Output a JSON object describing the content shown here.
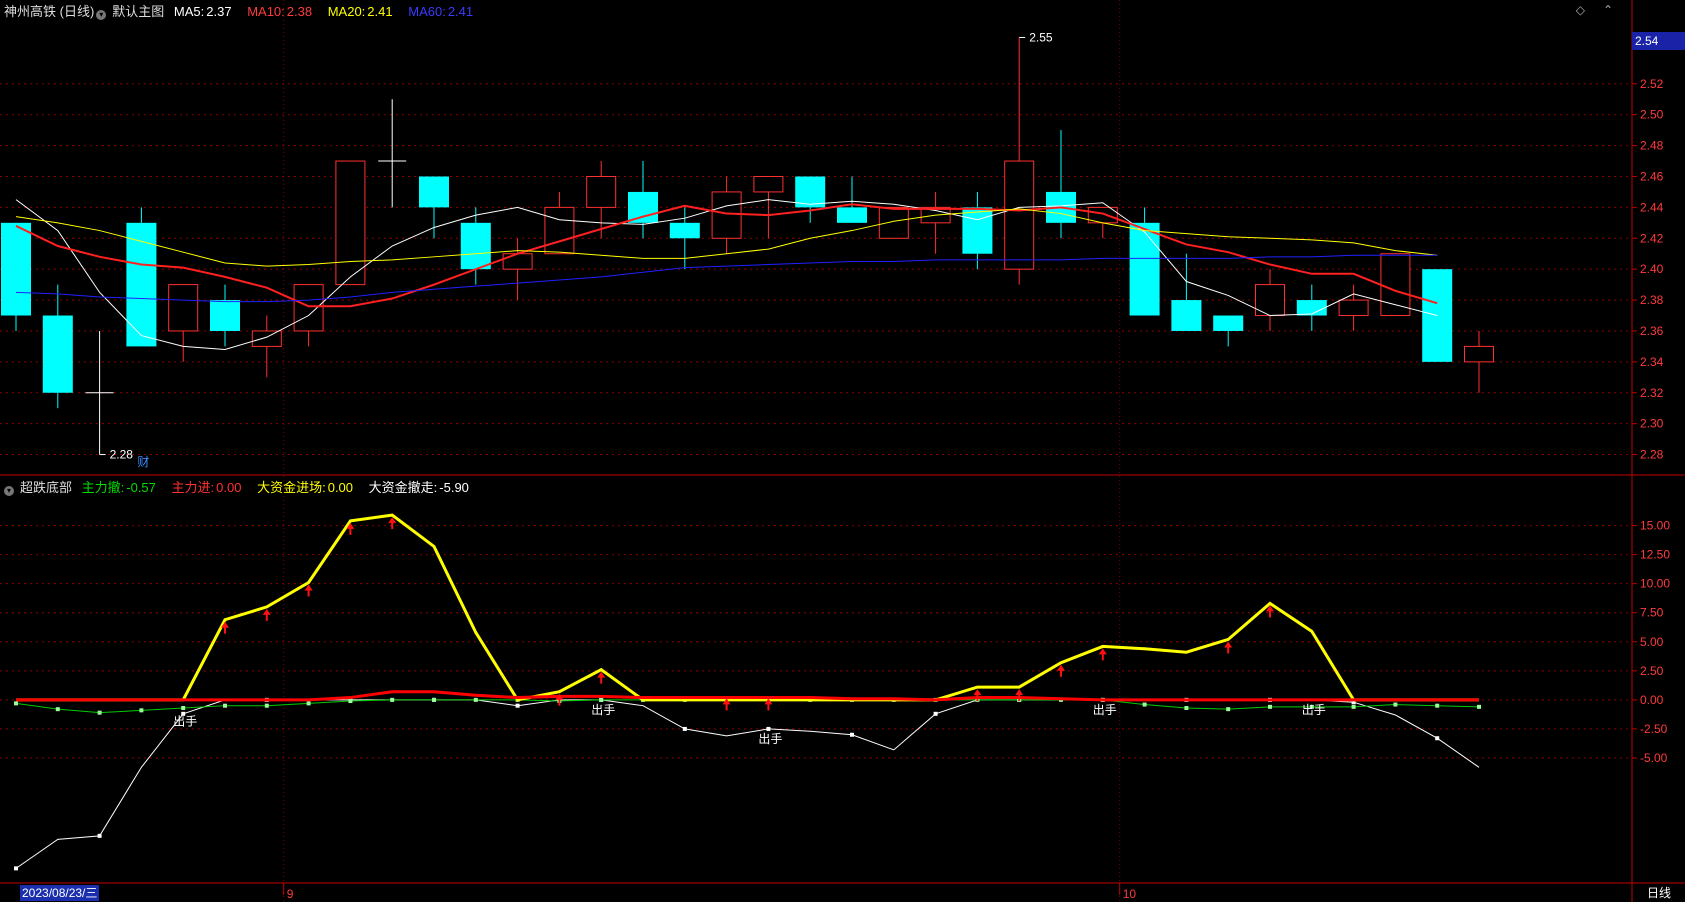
{
  "colors": {
    "up": "#ff3030",
    "down": "#00ffff",
    "doji": "#ffffff",
    "ma5": "#ffffff",
    "ma10": "#ff2020",
    "ma20": "#ffff00",
    "ma60": "#2020ff",
    "grid": "#8b0000",
    "axis": "#c00000",
    "ind_yellow": "#ffff00",
    "ind_red": "#ff0000",
    "ind_green": "#00cc00",
    "ind_white": "#ffffff"
  },
  "header": {
    "stock": "神州高铁 (日线)",
    "template": "默认主图",
    "ma5_label": "MA5:",
    "ma5": "2.37",
    "ma10_label": "MA10:",
    "ma10": "2.38",
    "ma20_label": "MA20:",
    "ma20": "2.41",
    "ma60_label": "MA60:",
    "ma60": "2.41",
    "right_icons": [
      "diamond-icon",
      "chevron-up-icon"
    ]
  },
  "indicator_header": {
    "name": "超跌底部",
    "k1": "主力撤:",
    "v1": "-0.57",
    "k2": "主力进:",
    "v2": "0.00",
    "k3": "大资金进场:",
    "v3": "0.00",
    "k4": "大资金撤走:",
    "v4": "-5.90"
  },
  "current_price": "2.54",
  "bottom": {
    "date": "2023/08/23/三",
    "freq": "日线",
    "month_ticks": [
      "9",
      "10"
    ]
  },
  "chart_data": [
    {
      "type": "candlestick",
      "title": "神州高铁 (日线)",
      "ylim": [
        2.27,
        2.56
      ],
      "yticks": [
        "2.28",
        "2.30",
        "2.32",
        "2.34",
        "2.36",
        "2.38",
        "2.40",
        "2.42",
        "2.44",
        "2.46",
        "2.48",
        "2.50",
        "2.52"
      ],
      "candles": [
        {
          "o": 2.43,
          "h": 2.43,
          "l": 2.36,
          "c": 2.37
        },
        {
          "o": 2.37,
          "h": 2.39,
          "l": 2.31,
          "c": 2.32
        },
        {
          "o": 2.32,
          "h": 2.36,
          "l": 2.28,
          "c": 2.32
        },
        {
          "o": 2.43,
          "h": 2.44,
          "l": 2.35,
          "c": 2.35
        },
        {
          "o": 2.36,
          "h": 2.39,
          "l": 2.34,
          "c": 2.39
        },
        {
          "o": 2.38,
          "h": 2.39,
          "l": 2.35,
          "c": 2.36
        },
        {
          "o": 2.35,
          "h": 2.37,
          "l": 2.33,
          "c": 2.36
        },
        {
          "o": 2.36,
          "h": 2.39,
          "l": 2.35,
          "c": 2.39
        },
        {
          "o": 2.39,
          "h": 2.47,
          "l": 2.39,
          "c": 2.47
        },
        {
          "o": 2.47,
          "h": 2.51,
          "l": 2.44,
          "c": 2.47
        },
        {
          "o": 2.46,
          "h": 2.46,
          "l": 2.42,
          "c": 2.44
        },
        {
          "o": 2.43,
          "h": 2.44,
          "l": 2.39,
          "c": 2.4
        },
        {
          "o": 2.4,
          "h": 2.42,
          "l": 2.38,
          "c": 2.41
        },
        {
          "o": 2.41,
          "h": 2.45,
          "l": 2.41,
          "c": 2.44
        },
        {
          "o": 2.44,
          "h": 2.47,
          "l": 2.42,
          "c": 2.46
        },
        {
          "o": 2.45,
          "h": 2.47,
          "l": 2.42,
          "c": 2.43
        },
        {
          "o": 2.43,
          "h": 2.44,
          "l": 2.4,
          "c": 2.42
        },
        {
          "o": 2.42,
          "h": 2.46,
          "l": 2.41,
          "c": 2.45
        },
        {
          "o": 2.45,
          "h": 2.46,
          "l": 2.42,
          "c": 2.46
        },
        {
          "o": 2.46,
          "h": 2.46,
          "l": 2.43,
          "c": 2.44
        },
        {
          "o": 2.44,
          "h": 2.46,
          "l": 2.43,
          "c": 2.43
        },
        {
          "o": 2.42,
          "h": 2.44,
          "l": 2.42,
          "c": 2.44
        },
        {
          "o": 2.43,
          "h": 2.45,
          "l": 2.41,
          "c": 2.44
        },
        {
          "o": 2.44,
          "h": 2.45,
          "l": 2.4,
          "c": 2.41
        },
        {
          "o": 2.4,
          "h": 2.55,
          "l": 2.39,
          "c": 2.47
        },
        {
          "o": 2.45,
          "h": 2.49,
          "l": 2.42,
          "c": 2.43
        },
        {
          "o": 2.43,
          "h": 2.44,
          "l": 2.42,
          "c": 2.44
        },
        {
          "o": 2.43,
          "h": 2.44,
          "l": 2.37,
          "c": 2.37
        },
        {
          "o": 2.38,
          "h": 2.41,
          "l": 2.36,
          "c": 2.36
        },
        {
          "o": 2.37,
          "h": 2.37,
          "l": 2.35,
          "c": 2.36
        },
        {
          "o": 2.37,
          "h": 2.4,
          "l": 2.36,
          "c": 2.39
        },
        {
          "o": 2.38,
          "h": 2.39,
          "l": 2.36,
          "c": 2.37
        },
        {
          "o": 2.37,
          "h": 2.39,
          "l": 2.36,
          "c": 2.38
        },
        {
          "o": 2.37,
          "h": 2.41,
          "l": 2.37,
          "c": 2.41
        },
        {
          "o": 2.4,
          "h": 2.4,
          "l": 2.34,
          "c": 2.34
        },
        {
          "o": 2.34,
          "h": 2.36,
          "l": 2.32,
          "c": 2.35
        }
      ],
      "series": [
        {
          "name": "MA5",
          "values": [
            2.445,
            2.425,
            2.385,
            2.357,
            2.35,
            2.348,
            2.356,
            2.37,
            2.395,
            2.415,
            2.427,
            2.435,
            2.44,
            2.432,
            2.43,
            2.429,
            2.433,
            2.441,
            2.445,
            2.442,
            2.444,
            2.442,
            2.438,
            2.432,
            2.44,
            2.441,
            2.443,
            2.424,
            2.392,
            2.383,
            2.37,
            2.371,
            2.384,
            2.377,
            2.37
          ]
        },
        {
          "name": "MA10",
          "values": [
            2.428,
            2.415,
            2.408,
            2.403,
            2.401,
            2.395,
            2.388,
            2.376,
            2.376,
            2.381,
            2.39,
            2.4,
            2.41,
            2.418,
            2.426,
            2.434,
            2.441,
            2.436,
            2.435,
            2.438,
            2.442,
            2.439,
            2.439,
            2.439,
            2.438,
            2.44,
            2.436,
            2.426,
            2.416,
            2.411,
            2.403,
            2.397,
            2.397,
            2.386,
            2.378
          ]
        },
        {
          "name": "MA20",
          "values": [
            2.434,
            2.43,
            2.425,
            2.418,
            2.411,
            2.404,
            2.402,
            2.403,
            2.405,
            2.406,
            2.408,
            2.41,
            2.412,
            2.411,
            2.409,
            2.407,
            2.407,
            2.41,
            2.413,
            2.42,
            2.425,
            2.431,
            2.435,
            2.437,
            2.439,
            2.436,
            2.43,
            2.425,
            2.423,
            2.421,
            2.42,
            2.419,
            2.417,
            2.412,
            2.409
          ]
        },
        {
          "name": "MA60",
          "values": [
            2.385,
            2.384,
            2.382,
            2.381,
            2.38,
            2.379,
            2.379,
            2.38,
            2.382,
            2.385,
            2.387,
            2.389,
            2.391,
            2.393,
            2.395,
            2.398,
            2.401,
            2.402,
            2.403,
            2.404,
            2.405,
            2.405,
            2.406,
            2.406,
            2.406,
            2.406,
            2.407,
            2.407,
            2.407,
            2.407,
            2.408,
            2.408,
            2.409,
            2.409,
            2.409
          ]
        }
      ],
      "annotations": [
        {
          "text": "2.28",
          "candle": 2,
          "price": 2.28
        },
        {
          "text": "2.55",
          "candle": 24,
          "price": 2.55
        },
        {
          "text": "财",
          "candle": 3
        }
      ]
    },
    {
      "type": "line",
      "title": "超跌底部",
      "ylim": [
        -15.5,
        17.2
      ],
      "yticks": [
        "15.00",
        "12.50",
        "10.00",
        "7.50",
        "5.00",
        "2.50",
        "0.00",
        "-2.50",
        "-5.00"
      ],
      "series": [
        {
          "name": "大资金进场",
          "values": [
            0,
            0,
            0,
            0,
            0,
            6.9,
            8.0,
            10.1,
            15.4,
            15.9,
            13.2,
            5.8,
            0,
            0.7,
            2.6,
            0,
            0,
            0,
            0,
            0,
            0,
            0,
            0,
            1.1,
            1.1,
            3.2,
            4.6,
            4.4,
            4.1,
            5.2,
            8.3,
            5.9,
            0,
            0,
            0,
            0
          ]
        },
        {
          "name": "主力进",
          "values": [
            0,
            0,
            0,
            0,
            0,
            0,
            0,
            0,
            0.2,
            0.7,
            0.7,
            0.4,
            0.2,
            0.3,
            0.3,
            0.2,
            0.2,
            0.2,
            0.2,
            0.2,
            0.1,
            0.1,
            0,
            0.2,
            0.2,
            0.1,
            0,
            0,
            0,
            0,
            0,
            0,
            0,
            0,
            0,
            0
          ]
        },
        {
          "name": "主力撤",
          "values": [
            -0.3,
            -0.8,
            -1.1,
            -0.9,
            -0.7,
            -0.5,
            -0.5,
            -0.3,
            -0.1,
            0,
            0,
            0,
            0,
            -0.1,
            0,
            0,
            0,
            0,
            0,
            0,
            0,
            0,
            0,
            0,
            0,
            0,
            0,
            -0.4,
            -0.7,
            -0.8,
            -0.6,
            -0.6,
            -0.6,
            -0.4,
            -0.5,
            -0.6
          ]
        },
        {
          "name": "大资金撤走",
          "values": [
            -14.5,
            -12.0,
            -11.7,
            -5.8,
            -1.2,
            0,
            0,
            0,
            0,
            0,
            0,
            0,
            -0.5,
            0,
            0,
            -0.5,
            -2.5,
            -3.1,
            -2.5,
            -2.7,
            -3.0,
            -4.3,
            -1.2,
            0,
            0,
            0,
            0,
            0,
            0,
            0,
            0,
            0,
            -0.2,
            -1.3,
            -3.3,
            -5.8
          ]
        }
      ],
      "markers_red_arrow": [
        5,
        6,
        7,
        8,
        9,
        13,
        14,
        17,
        18,
        23,
        24,
        25,
        26,
        29,
        30
      ],
      "labels": [
        {
          "text": "出手",
          "index": 4,
          "y": -1.0
        },
        {
          "text": "出手",
          "index": 14,
          "y": 0.0
        },
        {
          "text": "出手",
          "index": 18,
          "y": -2.5
        },
        {
          "text": "出手",
          "index": 26,
          "y": 0.0
        },
        {
          "text": "出手",
          "index": 31,
          "y": 0.0
        }
      ]
    }
  ]
}
